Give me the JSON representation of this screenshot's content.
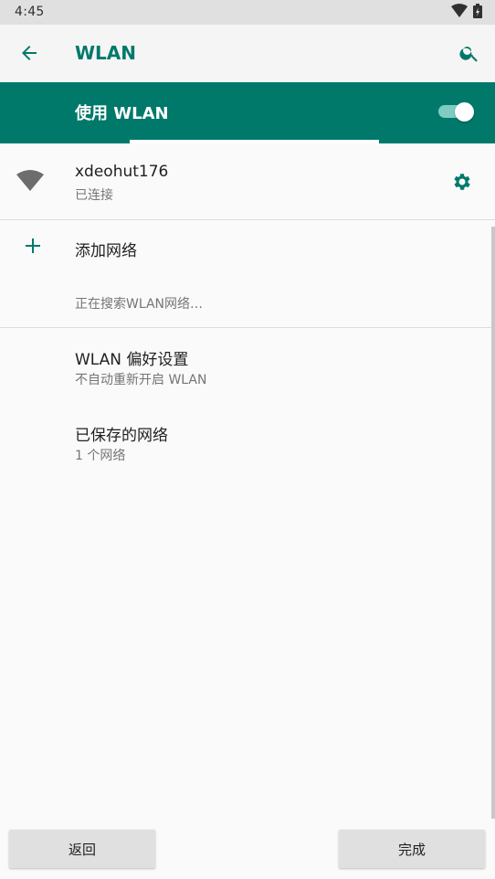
{
  "status_bar": {
    "time": "4:45",
    "icons": [
      "wifi-icon",
      "battery-icon"
    ]
  },
  "app_bar": {
    "title": "WLAN",
    "back_icon": "arrow-left-icon",
    "search_icon": "search-icon"
  },
  "master_switch": {
    "label": "使用 WLAN",
    "state": "on"
  },
  "scan_progress": {
    "segments": [
      {
        "start": 0.0,
        "end": 0.262
      },
      {
        "start": 0.766,
        "end": 1.0
      }
    ]
  },
  "connected_network": {
    "name": "xdeohut176",
    "status": "已连接",
    "icon": "wifi-signal-icon",
    "settings_icon": "gear-icon"
  },
  "add_network": {
    "label": "添加网络",
    "icon": "plus-icon"
  },
  "searching_text": "正在搜索WLAN网络…",
  "preferences": {
    "title": "WLAN 偏好设置",
    "subtitle": "不自动重新开启 WLAN"
  },
  "saved_networks": {
    "title": "已保存的网络",
    "subtitle": "1 个网络"
  },
  "buttons": {
    "back": "返回",
    "done": "完成"
  },
  "colors": {
    "accent": "#00796b",
    "accent_light": "#80cbc4",
    "background": "#fafafa",
    "status_bar": "#e0e0e0"
  }
}
